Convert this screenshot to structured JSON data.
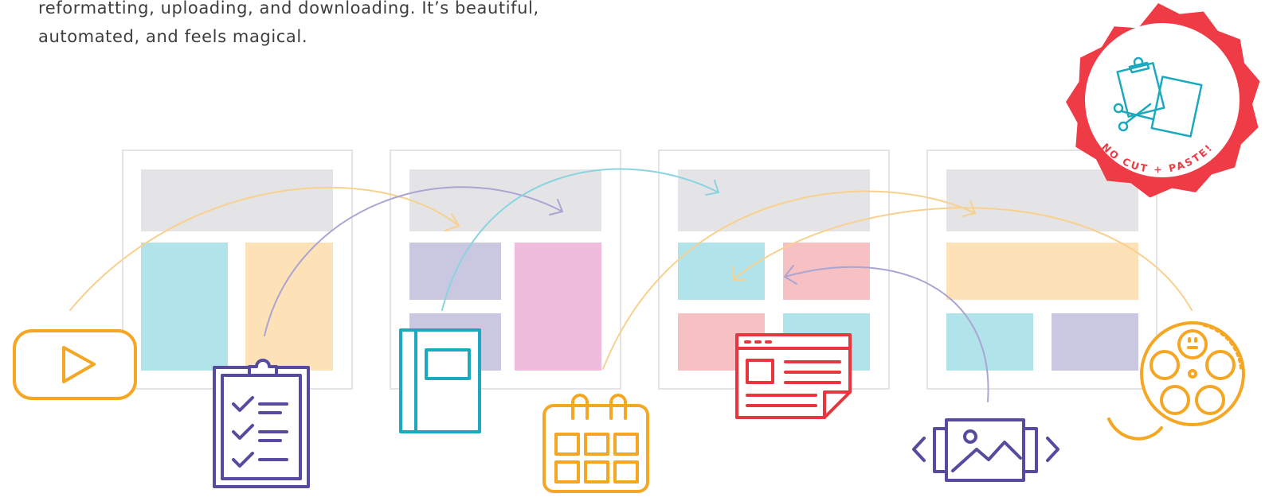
{
  "intro": {
    "line1": "reformatting, uploading, and downloading. It’s beautiful,",
    "line2": "automated, and feels magical."
  },
  "badge": {
    "text": "NO CUT + PASTE!",
    "color": "#ef3b46"
  },
  "colors": {
    "orange": "#f5a623",
    "purple": "#574b9f",
    "teal": "#1aa9bd",
    "red": "#e8363f",
    "frame": "#e4e4e6",
    "block_gray": "#e4e4e6",
    "block_teal": "#b1e3eb",
    "block_peach": "#fde2b8",
    "block_lavender": "#c9c8e0",
    "block_pink": "#efbcdc",
    "block_salmon": "#f7c0c2"
  },
  "icons": [
    "video-play-icon",
    "checklist-clipboard-icon",
    "notebook-icon",
    "calendar-icon",
    "article-document-icon",
    "image-carousel-icon",
    "film-reel-icon"
  ]
}
